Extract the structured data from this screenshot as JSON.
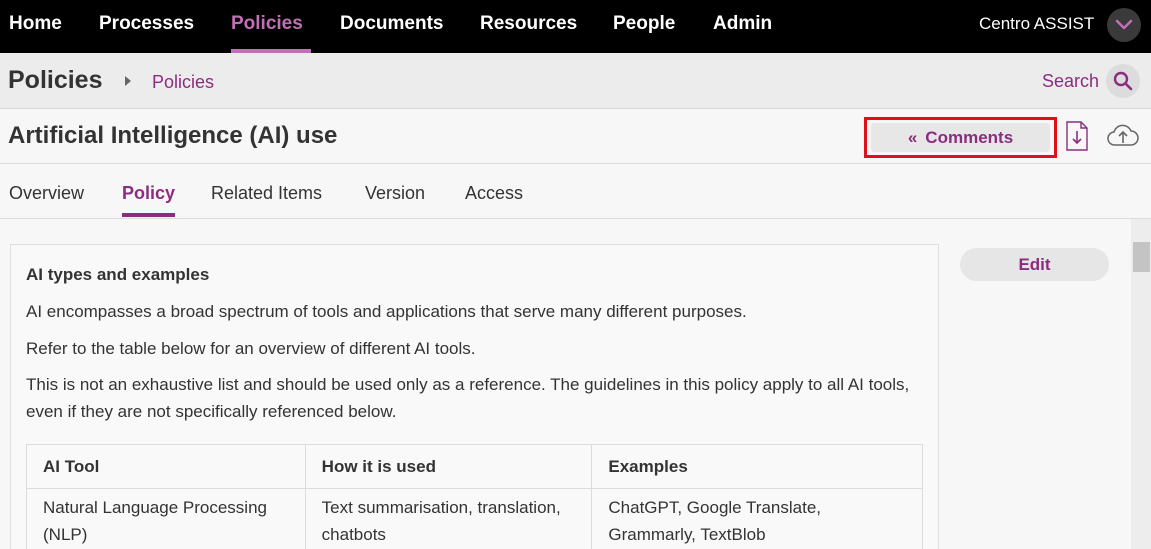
{
  "nav": {
    "items": [
      {
        "label": "Home",
        "active": false
      },
      {
        "label": "Processes",
        "active": false
      },
      {
        "label": "Policies",
        "active": true
      },
      {
        "label": "Documents",
        "active": false
      },
      {
        "label": "Resources",
        "active": false
      },
      {
        "label": "People",
        "active": false
      },
      {
        "label": "Admin",
        "active": false
      }
    ],
    "user_name": "Centro ASSIST",
    "user_menu_icon": "chevron-down-icon"
  },
  "breadcrumb": {
    "section": "Policies",
    "current": "Policies",
    "search_label": "Search",
    "search_icon": "search-icon"
  },
  "page": {
    "title": "Artificial Intelligence (AI) use",
    "comments_label": "Comments",
    "comments_icon": "double-chevron-left-icon",
    "download_icon": "download-icon",
    "upload_icon": "upload-cloud-icon"
  },
  "tabs": [
    {
      "label": "Overview",
      "active": false
    },
    {
      "label": "Policy",
      "active": true
    },
    {
      "label": "Related Items",
      "active": false
    },
    {
      "label": "Version",
      "active": false
    },
    {
      "label": "Access",
      "active": false
    }
  ],
  "content": {
    "heading": "AI types and examples",
    "paragraphs": [
      "AI encompasses a broad spectrum of tools and applications that serve many different purposes.",
      "Refer to the table below for an overview of different AI tools.",
      "This is not an exhaustive list and should be used only as a reference. The guidelines in this policy apply to all AI tools, even if they are not specifically referenced below."
    ],
    "table": {
      "headers": [
        "AI Tool",
        "How it is used",
        "Examples"
      ],
      "rows": [
        [
          "Natural Language Processing (NLP)",
          "Text summarisation, translation, chatbots",
          "ChatGPT, Google Translate, Grammarly, TextBlob"
        ]
      ]
    }
  },
  "edit_label": "Edit",
  "colors": {
    "accent": "#8b2d7f",
    "nav_active": "#c36fb8",
    "highlight_border": "#e0101b"
  }
}
